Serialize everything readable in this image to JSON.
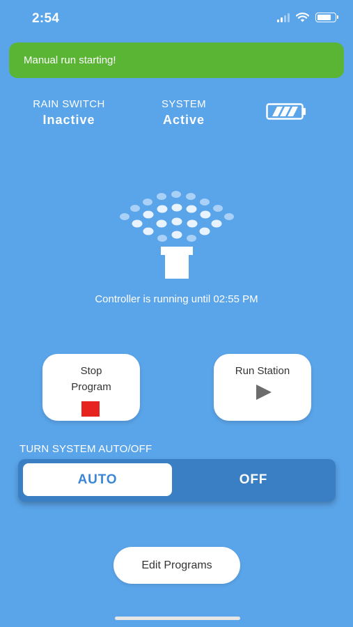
{
  "status_bar": {
    "time": "2:54"
  },
  "toast": {
    "message": "Manual run starting!"
  },
  "rain_switch": {
    "label": "RAIN SWITCH",
    "value": "Inactive"
  },
  "system": {
    "label": "SYSTEM",
    "value": "Active"
  },
  "battery": {
    "level_bars": 3,
    "max_bars": 3
  },
  "controller": {
    "status_text": "Controller is running until 02:55 PM"
  },
  "actions": {
    "stop_program": {
      "label_line1": "Stop",
      "label_line2": "Program",
      "icon": "stop-icon"
    },
    "run_station": {
      "label": "Run Station",
      "icon": "play-icon"
    }
  },
  "system_toggle": {
    "label": "TURN SYSTEM AUTO/OFF",
    "options": [
      "AUTO",
      "OFF"
    ],
    "selected": "AUTO"
  },
  "edit_programs": {
    "label": "Edit Programs"
  },
  "colors": {
    "background": "#5aa4e9",
    "toast": "#5ab535",
    "stop_red": "#e7231f",
    "toggle_bg": "#3a7fc4",
    "accent_text": "#3b86d6"
  }
}
